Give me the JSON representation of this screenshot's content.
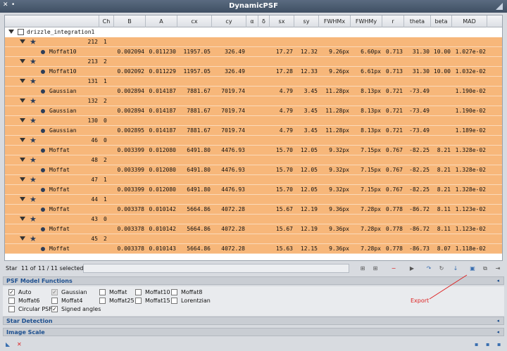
{
  "window": {
    "title": "DynamicPSF",
    "close_glyph": "✕",
    "pin_glyph": "•"
  },
  "columns": [
    "",
    "Ch",
    "B",
    "A",
    "cx",
    "cy",
    "α",
    "δ",
    "sx",
    "sy",
    "FWHMx",
    "FWHMy",
    "r",
    "theta",
    "beta",
    "MAD"
  ],
  "root_label": "drizzle_integration1",
  "stars": [
    {
      "id": "212",
      "ch": "1",
      "fit": [
        "Moffat10",
        "0.002094",
        "0.011230",
        "11957.05",
        "326.49",
        "",
        "",
        "17.27",
        "12.32",
        "9.26px",
        "6.60px",
        "0.713",
        "31.30",
        "10.00",
        "1.027e-02"
      ]
    },
    {
      "id": "213",
      "ch": "2",
      "fit": [
        "Moffat10",
        "0.002092",
        "0.011229",
        "11957.05",
        "326.49",
        "",
        "",
        "17.28",
        "12.33",
        "9.26px",
        "6.61px",
        "0.713",
        "31.30",
        "10.00",
        "1.032e-02"
      ]
    },
    {
      "id": "131",
      "ch": "1",
      "fit": [
        "Gaussian",
        "0.002894",
        "0.014187",
        "7881.67",
        "7019.74",
        "",
        "",
        "4.79",
        "3.45",
        "11.28px",
        "8.13px",
        "0.721",
        "-73.49",
        "",
        "1.190e-02"
      ]
    },
    {
      "id": "132",
      "ch": "2",
      "fit": [
        "Gaussian",
        "0.002894",
        "0.014187",
        "7881.67",
        "7019.74",
        "",
        "",
        "4.79",
        "3.45",
        "11.28px",
        "8.13px",
        "0.721",
        "-73.49",
        "",
        "1.190e-02"
      ]
    },
    {
      "id": "130",
      "ch": "0",
      "fit": [
        "Gaussian",
        "0.002895",
        "0.014187",
        "7881.67",
        "7019.74",
        "",
        "",
        "4.79",
        "3.45",
        "11.28px",
        "8.13px",
        "0.721",
        "-73.49",
        "",
        "1.189e-02"
      ]
    },
    {
      "id": "46",
      "ch": "0",
      "fit": [
        "Moffat",
        "0.003399",
        "0.012080",
        "6491.80",
        "4476.93",
        "",
        "",
        "15.70",
        "12.05",
        "9.32px",
        "7.15px",
        "0.767",
        "-82.25",
        "8.21",
        "1.328e-02"
      ]
    },
    {
      "id": "48",
      "ch": "2",
      "fit": [
        "Moffat",
        "0.003399",
        "0.012080",
        "6491.80",
        "4476.93",
        "",
        "",
        "15.70",
        "12.05",
        "9.32px",
        "7.15px",
        "0.767",
        "-82.25",
        "8.21",
        "1.328e-02"
      ]
    },
    {
      "id": "47",
      "ch": "1",
      "fit": [
        "Moffat",
        "0.003399",
        "0.012080",
        "6491.80",
        "4476.93",
        "",
        "",
        "15.70",
        "12.05",
        "9.32px",
        "7.15px",
        "0.767",
        "-82.25",
        "8.21",
        "1.328e-02"
      ]
    },
    {
      "id": "44",
      "ch": "1",
      "fit": [
        "Moffat",
        "0.003378",
        "0.010142",
        "5664.86",
        "4072.28",
        "",
        "",
        "15.67",
        "12.19",
        "9.36px",
        "7.28px",
        "0.778",
        "-86.72",
        "8.11",
        "1.123e-02"
      ]
    },
    {
      "id": "43",
      "ch": "0",
      "fit": [
        "Moffat",
        "0.003378",
        "0.010142",
        "5664.86",
        "4072.28",
        "",
        "",
        "15.67",
        "12.19",
        "9.36px",
        "7.28px",
        "0.778",
        "-86.72",
        "8.11",
        "1.123e-02"
      ]
    },
    {
      "id": "45",
      "ch": "2",
      "fit": [
        "Moffat",
        "0.003378",
        "0.010143",
        "5664.86",
        "4072.28",
        "",
        "",
        "15.63",
        "12.15",
        "9.36px",
        "7.28px",
        "0.778",
        "-86.73",
        "8.07",
        "1.118e-02"
      ]
    }
  ],
  "status": {
    "star_label": "Star",
    "index_text": "11 of",
    "selected_text": "11 / 11 selected"
  },
  "sections": {
    "psf_models": "PSF Model Functions",
    "star_detection": "Star Detection",
    "image_scale": "Image Scale"
  },
  "models": [
    {
      "label": "Auto",
      "checked": true,
      "disabled": false
    },
    {
      "label": "Gaussian",
      "checked": true,
      "disabled": true
    },
    {
      "label": "Moffat",
      "checked": false,
      "disabled": false
    },
    {
      "label": "Moffat10",
      "checked": false,
      "disabled": false
    },
    {
      "label": "Moffat8",
      "checked": false,
      "disabled": false
    },
    {
      "label": "Moffat6",
      "checked": false,
      "disabled": false
    },
    {
      "label": "Moffat4",
      "checked": false,
      "disabled": false
    },
    {
      "label": "Moffat25",
      "checked": false,
      "disabled": false
    },
    {
      "label": "Moffat15",
      "checked": false,
      "disabled": false
    },
    {
      "label": "Lorentzian",
      "checked": false,
      "disabled": false
    },
    {
      "label": "Circular PSF",
      "checked": false,
      "disabled": false
    },
    {
      "label": "Signed angles",
      "checked": true,
      "disabled": false
    }
  ],
  "annotation": {
    "export_label": "Export",
    "color": "#dd2222"
  },
  "colors": {
    "row_highlight": "#f7b77a",
    "section_title": "#1d4f8f"
  }
}
